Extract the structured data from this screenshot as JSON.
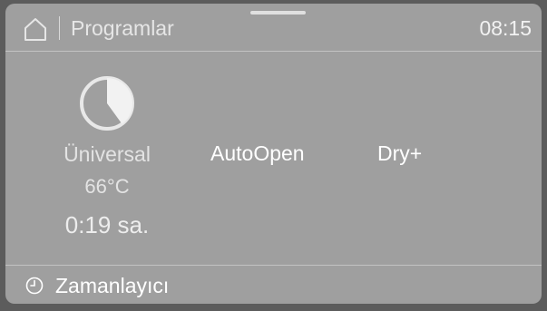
{
  "header": {
    "title": "Programlar",
    "clock": "08:15",
    "home_icon": "home-icon"
  },
  "program": {
    "icon": "program-progress-icon",
    "name": "Üniversal",
    "temperature": "66°C",
    "duration": "0:19 sa.",
    "progress_fraction": 0.4
  },
  "options": [
    {
      "label": "AutoOpen"
    },
    {
      "label": "Dry+"
    }
  ],
  "footer": {
    "icon": "clock-icon",
    "label": "Zamanlayıcı"
  },
  "colors": {
    "screen_background": "#9f9f9f",
    "bezel": "#5c5c5c",
    "text": "#ffffff"
  }
}
